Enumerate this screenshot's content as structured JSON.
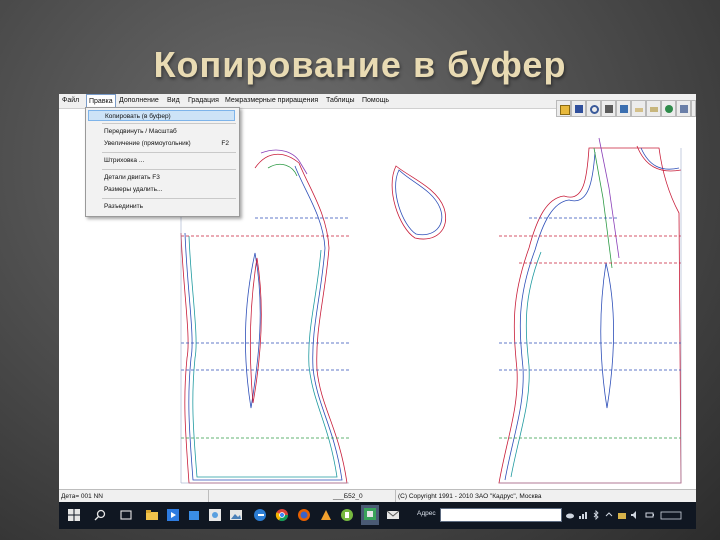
{
  "slide": {
    "title": "Копирование в буфер"
  },
  "app": {
    "menu": [
      "Файл",
      "Правка",
      "Дополнение",
      "Вид",
      "Градация",
      "Межразмерные приращения",
      "Таблицы",
      "Помощь"
    ],
    "active_menu": "Правка",
    "dropdown": {
      "items": [
        {
          "label": "Копировать (в буфер)",
          "shortcut": "",
          "highlighted": true
        },
        {
          "label": "Передвинуть / Масштаб",
          "shortcut": ""
        },
        {
          "label": "Увеличение (прямоугольник)",
          "shortcut": "F2"
        },
        {
          "label": "Штриховка ...",
          "shortcut": ""
        },
        {
          "label": "Детали двигать F3",
          "shortcut": ""
        },
        {
          "label": "Размеры удалить...",
          "shortcut": ""
        },
        {
          "label": "Разъединить",
          "shortcut": ""
        }
      ]
    },
    "toolbar_icons": [
      "open-folder-icon",
      "save-disk-icon",
      "magnifier-icon",
      "printer-icon",
      "scanner-icon",
      "ruler-icon",
      "measure-icon",
      "settings-icon",
      "layers-icon",
      "exit-icon"
    ],
    "status": {
      "detail": "Дета= 001 NN",
      "code": "___Б52_0",
      "copyright": "(C) Copyright 1991 - 2010 ЗАО \"Кадрус\", Москва"
    },
    "taskbar": {
      "address_label": "Адрес",
      "icons": [
        "windows-start-icon",
        "search-icon",
        "task-view-icon",
        "file-explorer-icon",
        "media-player-icon",
        "store-icon",
        "photos-icon",
        "image-viewer-icon",
        "edge-icon",
        "chrome-icon",
        "firefox-icon",
        "tools-icon",
        "utorrent-icon",
        "cad-app-icon",
        "mail-icon"
      ],
      "tray_icons": [
        "cloud-icon",
        "network-icon",
        "bluetooth-icon",
        "chevron-icon",
        "folder-tray-icon",
        "volume-icon",
        "battery-icon",
        "keyboard-icon"
      ]
    }
  }
}
